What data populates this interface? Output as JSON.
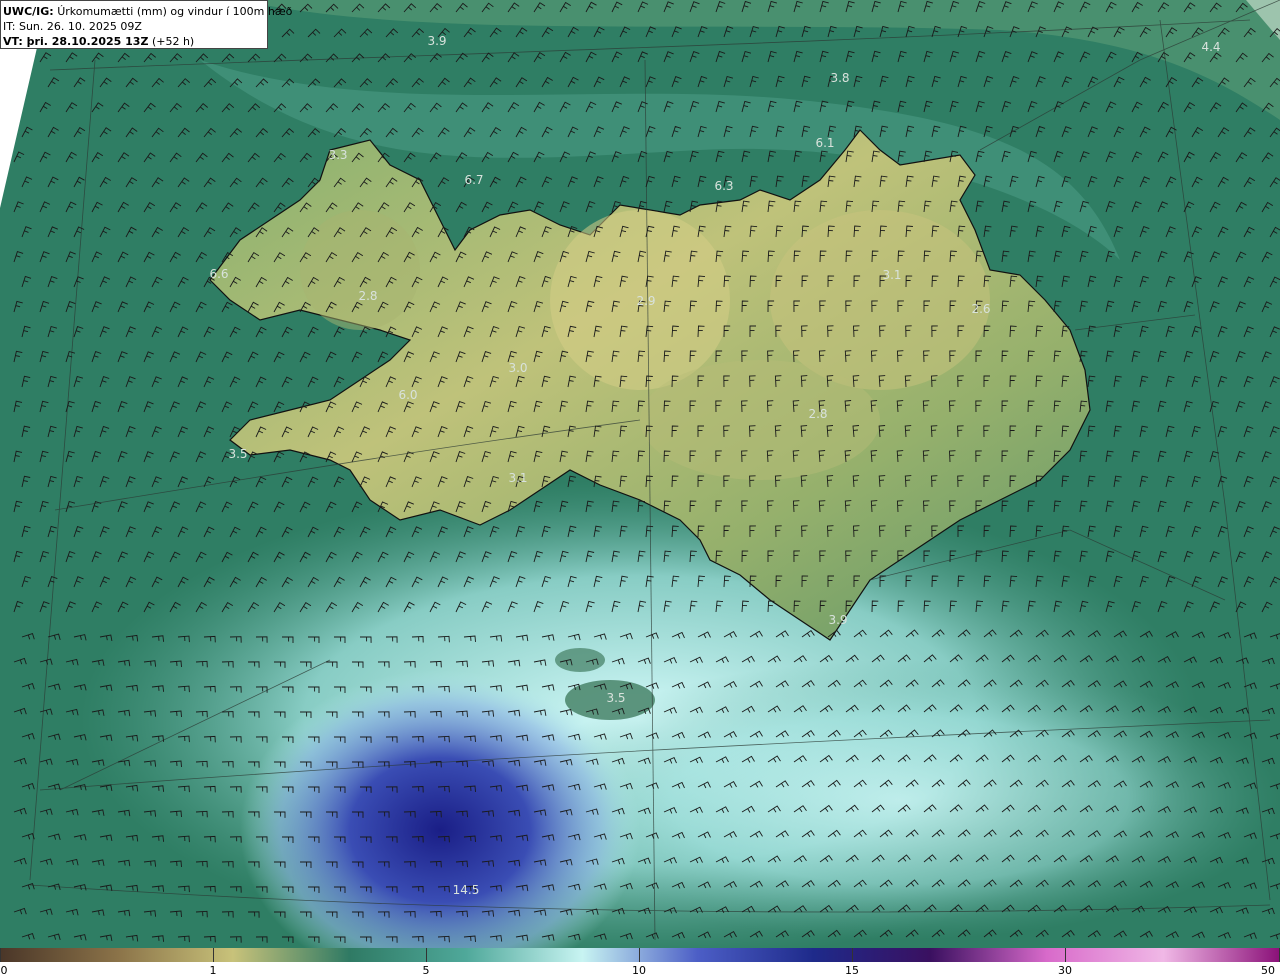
{
  "header": {
    "product": "UWC/IG:",
    "description": "Úrkomumætti (mm) og vindur í 100m hæð",
    "it_label": "IT:",
    "it_value": "Sun. 26. 10. 2025 09Z",
    "vt_label": "VT: þri. 28.10.2025 13Z",
    "vt_lead": "(+52 h)"
  },
  "value_labels": [
    "3.9",
    "4.4",
    "3.8",
    "6.1",
    "3.3",
    "6.7",
    "6.3",
    "6.6",
    "2.8",
    "2.9",
    "3.1",
    "2.6",
    "3.0",
    "6.0",
    "2.8",
    "3.5",
    "3.1",
    "3.9",
    "3.5",
    "14.5"
  ],
  "colorbar": {
    "ticks": [
      "0",
      "1",
      "5",
      "10",
      "15",
      "30",
      "50"
    ],
    "colors": [
      "#4a3628",
      "#8a7248",
      "#c8c27a",
      "#2f7a64",
      "#4fa89a",
      "#c8f4f2",
      "#4c5ec6",
      "#1e2a8a",
      "#3a1060",
      "#d86aca",
      "#f0b8e6",
      "#8a1078"
    ]
  },
  "colors": {
    "land_high": "#cbcb7c",
    "land_mid": "#6aa068",
    "sea": "#2f7e64",
    "heavy_precip": "#2a3a9e"
  }
}
